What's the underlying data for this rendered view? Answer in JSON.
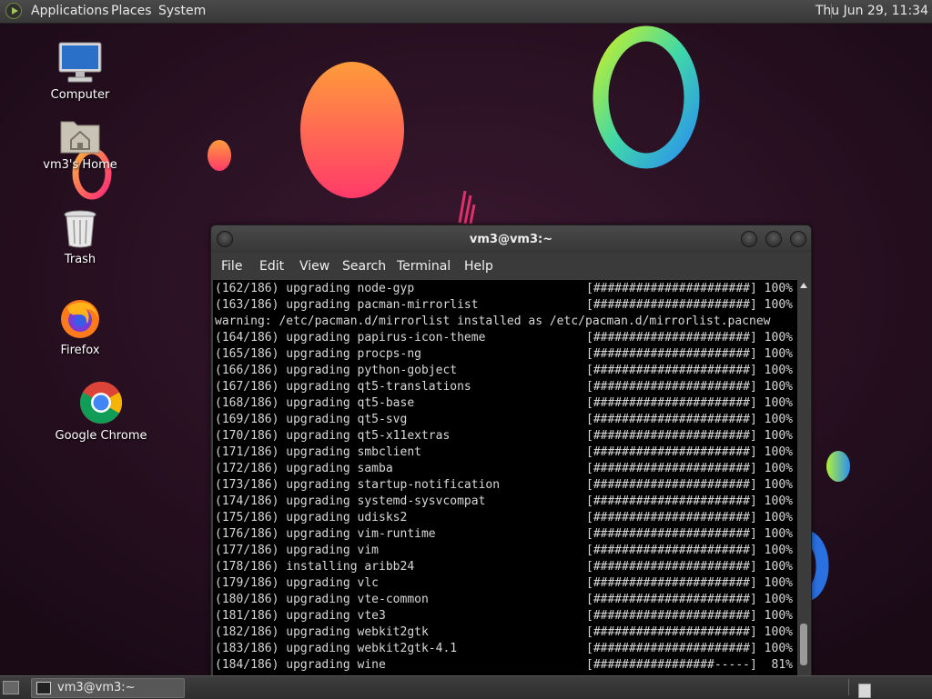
{
  "top_panel": {
    "menus": [
      "Applications",
      "Places",
      "System"
    ],
    "clock": "Thu Jun 29, 11:34"
  },
  "desktop_icons": [
    {
      "label": "Computer",
      "icon": "computer-icon"
    },
    {
      "label": "vm3's Home",
      "icon": "home-folder-icon"
    },
    {
      "label": "Trash",
      "icon": "trash-icon"
    },
    {
      "label": "Firefox",
      "icon": "firefox-icon"
    },
    {
      "label": "Google Chrome",
      "icon": "chrome-icon"
    }
  ],
  "terminal": {
    "title": "vm3@vm3:~",
    "menu": [
      "File",
      "Edit",
      "View",
      "Search",
      "Terminal",
      "Help"
    ],
    "lines": [
      {
        "text": "(162/186) upgrading node-gyp",
        "progress": "[######################] 100%"
      },
      {
        "text": "(163/186) upgrading pacman-mirrorlist",
        "progress": "[######################] 100%"
      },
      {
        "text": "warning: /etc/pacman.d/mirrorlist installed as /etc/pacman.d/mirrorlist.pacnew",
        "progress": ""
      },
      {
        "text": "(164/186) upgrading papirus-icon-theme",
        "progress": "[######################] 100%"
      },
      {
        "text": "(165/186) upgrading procps-ng",
        "progress": "[######################] 100%"
      },
      {
        "text": "(166/186) upgrading python-gobject",
        "progress": "[######################] 100%"
      },
      {
        "text": "(167/186) upgrading qt5-translations",
        "progress": "[######################] 100%"
      },
      {
        "text": "(168/186) upgrading qt5-base",
        "progress": "[######################] 100%"
      },
      {
        "text": "(169/186) upgrading qt5-svg",
        "progress": "[######################] 100%"
      },
      {
        "text": "(170/186) upgrading qt5-x11extras",
        "progress": "[######################] 100%"
      },
      {
        "text": "(171/186) upgrading smbclient",
        "progress": "[######################] 100%"
      },
      {
        "text": "(172/186) upgrading samba",
        "progress": "[######################] 100%"
      },
      {
        "text": "(173/186) upgrading startup-notification",
        "progress": "[######################] 100%"
      },
      {
        "text": "(174/186) upgrading systemd-sysvcompat",
        "progress": "[######################] 100%"
      },
      {
        "text": "(175/186) upgrading udisks2",
        "progress": "[######################] 100%"
      },
      {
        "text": "(176/186) upgrading vim-runtime",
        "progress": "[######################] 100%"
      },
      {
        "text": "(177/186) upgrading vim",
        "progress": "[######################] 100%"
      },
      {
        "text": "(178/186) installing aribb24",
        "progress": "[######################] 100%"
      },
      {
        "text": "(179/186) upgrading vlc",
        "progress": "[######################] 100%"
      },
      {
        "text": "(180/186) upgrading vte-common",
        "progress": "[######################] 100%"
      },
      {
        "text": "(181/186) upgrading vte3",
        "progress": "[######################] 100%"
      },
      {
        "text": "(182/186) upgrading webkit2gtk",
        "progress": "[######################] 100%"
      },
      {
        "text": "(183/186) upgrading webkit2gtk-4.1",
        "progress": "[######################] 100%"
      },
      {
        "text": "(184/186) upgrading wine",
        "progress": "[#################-----]  81%"
      }
    ]
  },
  "taskbar": {
    "window_label": "vm3@vm3:~"
  }
}
